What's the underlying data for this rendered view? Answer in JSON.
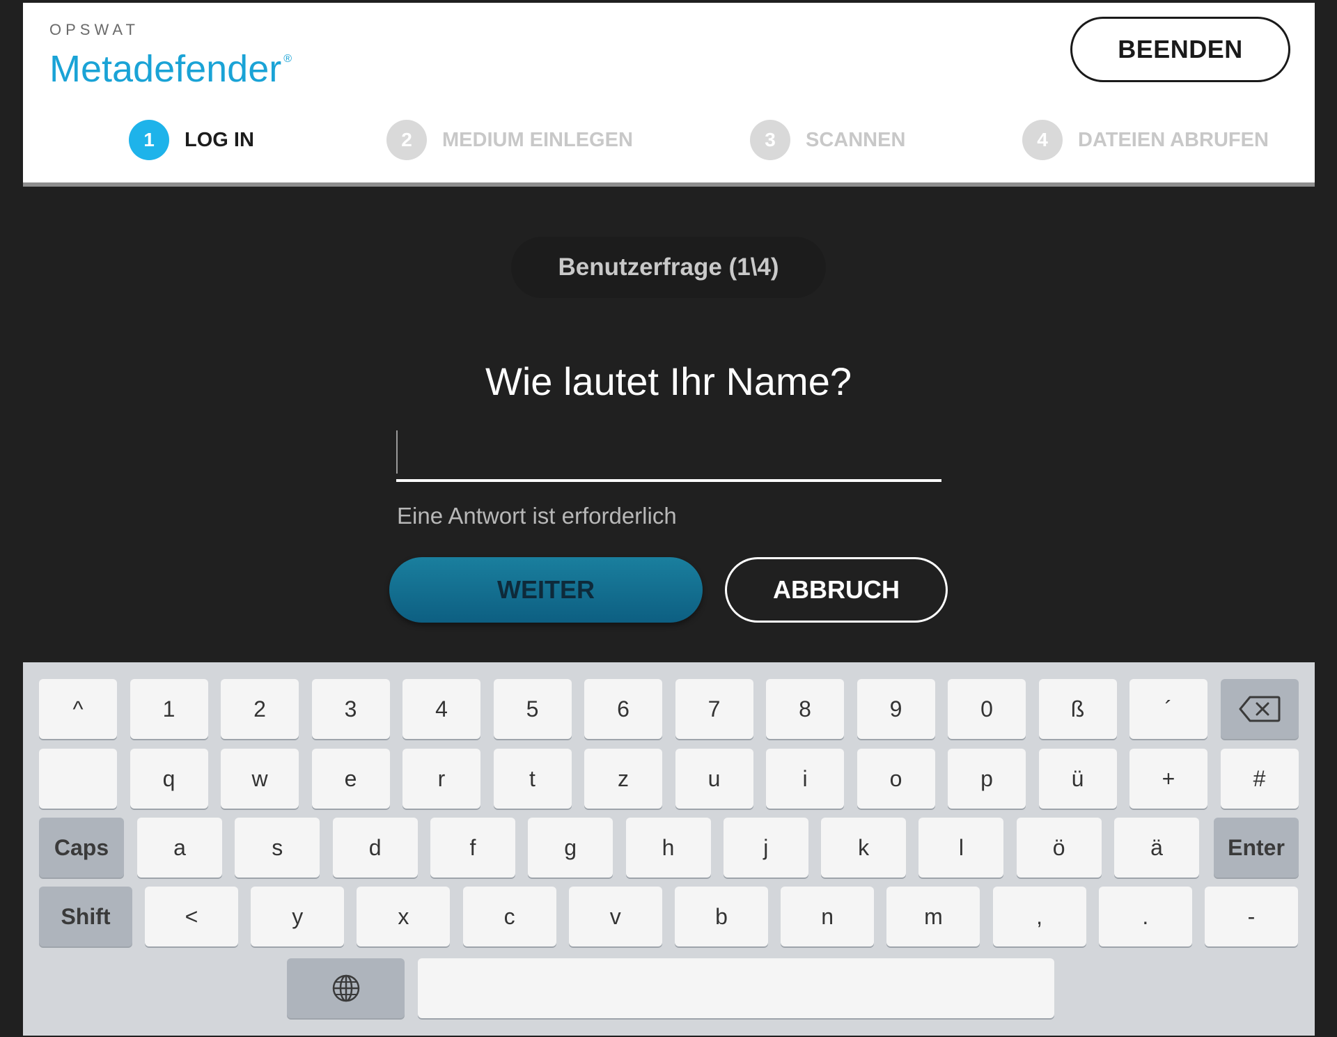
{
  "brand": {
    "company": "OPSWAT",
    "product": "Metadefender",
    "registered": "®"
  },
  "header": {
    "exit_label": "BEENDEN"
  },
  "steps": [
    {
      "number": "1",
      "label": "LOG IN",
      "active": true
    },
    {
      "number": "2",
      "label": "MEDIUM EINLEGEN",
      "active": false
    },
    {
      "number": "3",
      "label": "SCANNEN",
      "active": false
    },
    {
      "number": "4",
      "label": "DATEIEN ABRUFEN",
      "active": false
    }
  ],
  "form": {
    "counter": "Benutzerfrage (1\\4)",
    "question": "Wie lautet Ihr Name?",
    "answer_value": "",
    "hint": "Eine Antwort ist erforderlich",
    "next_label": "WEITER",
    "cancel_label": "ABBRUCH"
  },
  "keyboard": {
    "row1": [
      "^",
      "1",
      "2",
      "3",
      "4",
      "5",
      "6",
      "7",
      "8",
      "9",
      "0",
      "ß",
      "´"
    ],
    "row2": [
      "",
      "q",
      "w",
      "e",
      "r",
      "t",
      "z",
      "u",
      "i",
      "o",
      "p",
      "ü",
      "+",
      "#"
    ],
    "row3": [
      "a",
      "s",
      "d",
      "f",
      "g",
      "h",
      "j",
      "k",
      "l",
      "ö",
      "ä"
    ],
    "row4": [
      "<",
      "y",
      "x",
      "c",
      "v",
      "b",
      "n",
      "m",
      ",",
      ".",
      "-"
    ],
    "caps_label": "Caps",
    "enter_label": "Enter",
    "shift_label": "Shift",
    "backspace_icon": "backspace-icon",
    "language_icon": "globe-icon"
  },
  "colors": {
    "accent": "#1eb3ea",
    "brand": "#1aa3d6",
    "primary_button": "#136f90",
    "background": "#202020",
    "keyboard": "#d3d6da"
  }
}
